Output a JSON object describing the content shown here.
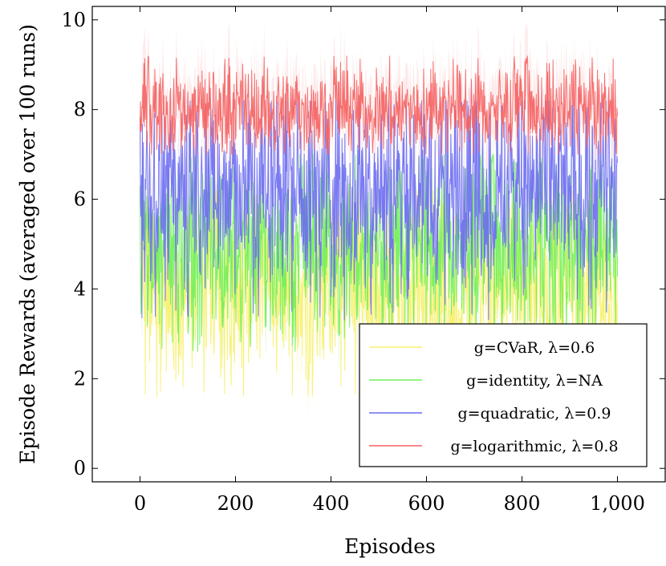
{
  "chart_data": {
    "type": "line",
    "xlabel": "Episodes",
    "ylabel": "Episode Rewards (averaged over 100 runs)",
    "xlim": [
      -100,
      1100
    ],
    "ylim": [
      -0.3,
      10.3
    ],
    "xticks": [
      0,
      200,
      400,
      600,
      800,
      1000
    ],
    "xtick_labels": [
      "0",
      "200",
      "400",
      "600",
      "800",
      "1,000"
    ],
    "yticks": [
      0,
      2,
      4,
      6,
      8,
      10
    ],
    "ytick_labels": [
      "0",
      "2",
      "4",
      "6",
      "8",
      "10"
    ],
    "grid": false,
    "legend_position": "bottom-right",
    "episodes": 1000,
    "series": [
      {
        "name": "g=CVaR, λ=0.6",
        "color": "#f7f06e",
        "mean": 4.0,
        "min": 1.6,
        "max": 6.2
      },
      {
        "name": "g=identity, λ=NA",
        "color": "#6ff05a",
        "mean": 4.9,
        "min": 2.6,
        "max": 7.0
      },
      {
        "name": "g=quadratic, λ=0.9",
        "color": "#6b6bf2",
        "mean": 6.2,
        "min": 3.3,
        "max": 8.2
      },
      {
        "name": "g=logarithmic, λ=0.8",
        "color": "#f56060",
        "mean": 8.0,
        "min": 7.0,
        "max": 9.2
      }
    ]
  }
}
